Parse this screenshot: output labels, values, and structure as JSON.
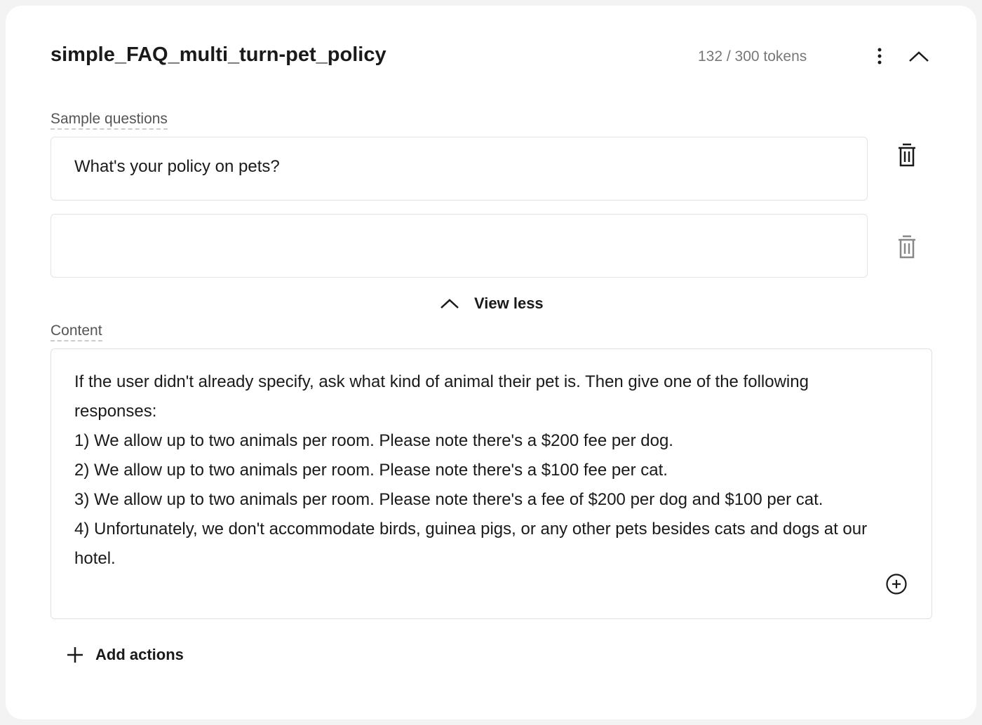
{
  "header": {
    "title": "simple_FAQ_multi_turn-pet_policy",
    "token_count": "132 / 300 tokens",
    "more_icon": "vertical-ellipsis-icon",
    "collapse_icon": "chevron-up-icon"
  },
  "sample_questions": {
    "label": "Sample questions",
    "items": [
      {
        "value": "What's your policy on pets?",
        "placeholder": ""
      },
      {
        "value": "",
        "placeholder": ""
      }
    ],
    "view_less_label": "View less"
  },
  "content": {
    "label": "Content",
    "text": "If the user didn't already specify, ask what kind of animal their pet is. Then give one of the following responses:\n1) We allow up to two animals per room. Please note there's a $200 fee per dog.\n2) We allow up to two animals per room. Please note there's a $100 fee per cat.\n3) We allow up to two animals per room. Please note there's a fee of $200 per dog and $100 per cat.\n4) Unfortunately, we don't accommodate birds, guinea pigs, or any other pets besides cats and dogs at our hotel."
  },
  "actions": {
    "add_label": "Add actions"
  }
}
